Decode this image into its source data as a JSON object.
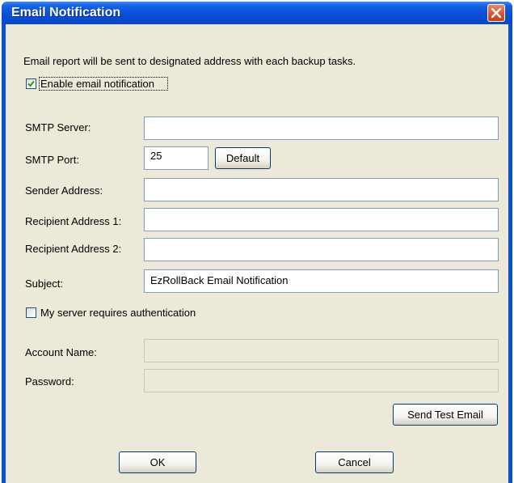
{
  "window": {
    "title": "Email Notification"
  },
  "description": "Email report will be sent to designated address with each backup tasks.",
  "enable_checkbox": {
    "label": "Enable email notification",
    "checked": true
  },
  "fields": {
    "smtp_server": {
      "label": "SMTP Server:",
      "value": ""
    },
    "smtp_port": {
      "label": "SMTP Port:",
      "value": "25"
    },
    "default_button": "Default",
    "sender_address": {
      "label": "Sender Address:",
      "value": ""
    },
    "recipient_1": {
      "label": "Recipient Address 1:",
      "value": ""
    },
    "recipient_2": {
      "label": "Recipient Address 2:",
      "value": ""
    },
    "subject": {
      "label": "Subject:",
      "value": "EzRollBack Email Notification"
    }
  },
  "auth_checkbox": {
    "label": "My server requires authentication",
    "checked": false
  },
  "auth": {
    "account_name": {
      "label": "Account Name:",
      "value": ""
    },
    "password": {
      "label": "Password:",
      "value": ""
    }
  },
  "buttons": {
    "send_test": "Send Test Email",
    "ok": "OK",
    "cancel": "Cancel"
  },
  "icons": {
    "close": "close-icon",
    "check": "checkmark-icon"
  },
  "colors": {
    "titlebar": "#0a4fd6",
    "client": "#ece9d8",
    "check": "#21a121",
    "close": "#d5532e"
  }
}
